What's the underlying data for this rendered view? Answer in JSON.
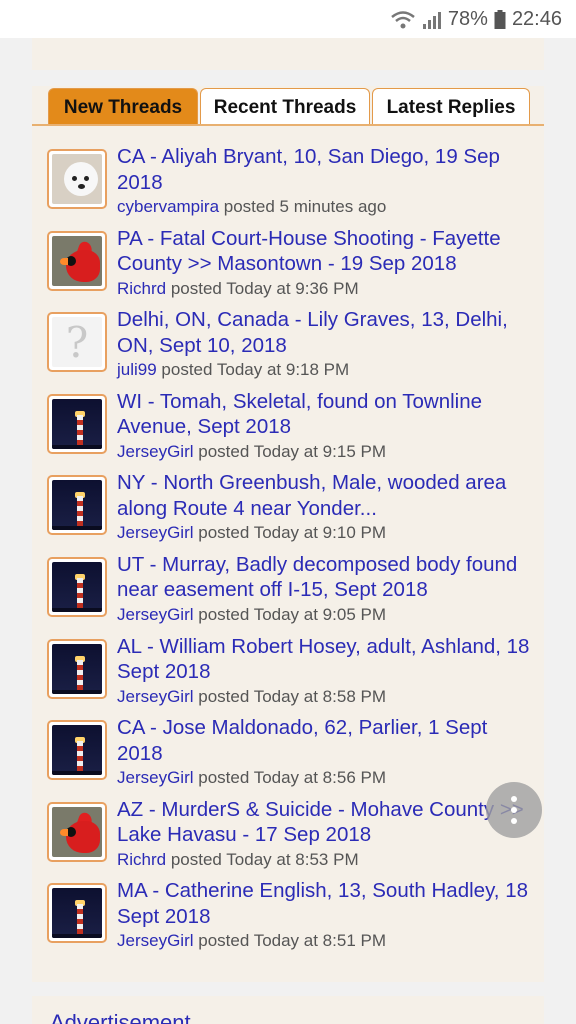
{
  "status_bar": {
    "battery": "78%",
    "time": "22:46",
    "icons": [
      "wifi-icon",
      "signal-icon",
      "battery-icon"
    ]
  },
  "tabs": [
    {
      "label": "New Threads",
      "active": true
    },
    {
      "label": "Recent Threads",
      "active": false
    },
    {
      "label": "Latest Replies",
      "active": false
    }
  ],
  "threads": [
    {
      "title": "CA - Aliyah Bryant, 10, San Diego, 19 Sep 2018",
      "user": "cybervampira",
      "meta": " posted 5 minutes ago",
      "avatar": "dog-avatar"
    },
    {
      "title": "PA - Fatal Court-House Shooting - Fayette County >> Masontown - 19 Sep 2018",
      "user": "Richrd",
      "meta": " posted Today at 9:36 PM",
      "avatar": "cardinal-avatar"
    },
    {
      "title": "Delhi, ON, Canada - Lily Graves, 13, Delhi, ON, Sept 10, 2018",
      "user": "juli99",
      "meta": " posted Today at 9:18 PM",
      "avatar": "unknown-avatar"
    },
    {
      "title": "WI - Tomah, Skeletal, found on Townline Avenue, Sept 2018",
      "user": "JerseyGirl",
      "meta": " posted Today at 9:15 PM",
      "avatar": "lighthouse-avatar"
    },
    {
      "title": "NY - North Greenbush, Male, wooded area along Route 4 near Yonder...",
      "user": "JerseyGirl",
      "meta": " posted Today at 9:10 PM",
      "avatar": "lighthouse-avatar"
    },
    {
      "title": "UT - Murray, Badly decomposed body found near easement off I-15, Sept 2018",
      "user": "JerseyGirl",
      "meta": " posted Today at 9:05 PM",
      "avatar": "lighthouse-avatar"
    },
    {
      "title": "AL - William Robert Hosey, adult, Ashland, 18 Sept 2018",
      "user": "JerseyGirl",
      "meta": " posted Today at 8:58 PM",
      "avatar": "lighthouse-avatar"
    },
    {
      "title": "CA - Jose Maldonado, 62, Parlier, 1 Sept 2018",
      "user": "JerseyGirl",
      "meta": " posted Today at 8:56 PM",
      "avatar": "lighthouse-avatar"
    },
    {
      "title": "AZ - MurderS & Suicide - Mohave County >> Lake Havasu - 17 Sep 2018",
      "user": "Richrd",
      "meta": " posted Today at 8:53 PM",
      "avatar": "cardinal-avatar"
    },
    {
      "title": "MA - Catherine English, 13, South Hadley, 18 Sept 2018",
      "user": "JerseyGirl",
      "meta": " posted Today at 8:51 PM",
      "avatar": "lighthouse-avatar"
    }
  ],
  "advertisement": {
    "label": "Advertisement"
  },
  "colors": {
    "accent": "#e38a1a",
    "link": "#2b2bb6",
    "panel": "#f5f0e8"
  }
}
